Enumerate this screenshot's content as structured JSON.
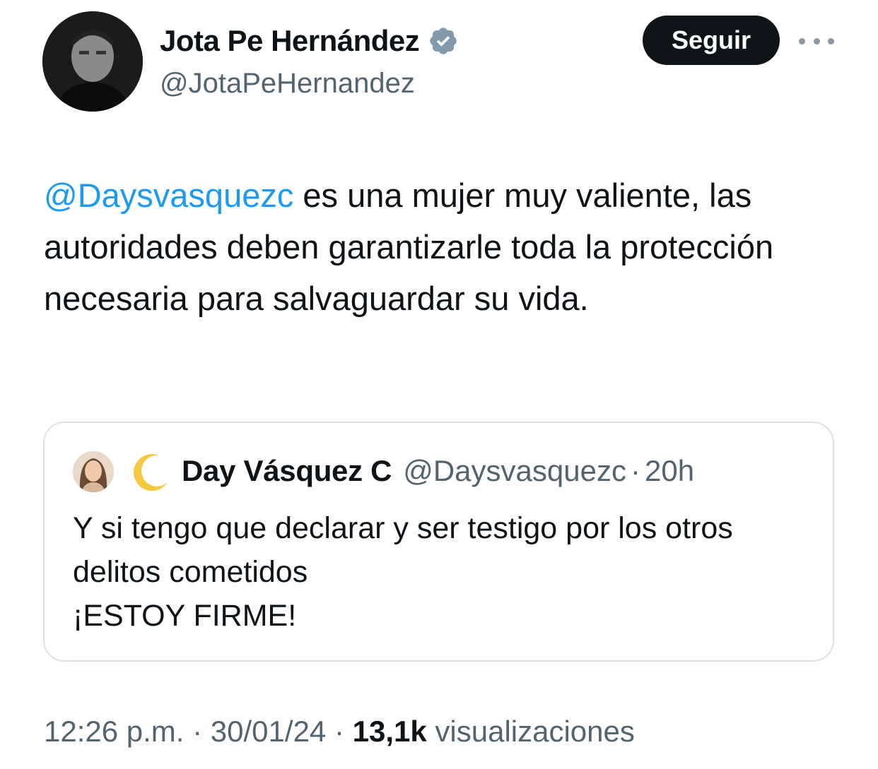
{
  "author": {
    "name": "Jota Pe Hernández",
    "handle": "@JotaPeHernandez",
    "verified": true,
    "avatar_icon": "avatar-photo"
  },
  "actions": {
    "follow_label": "Seguir",
    "more_icon": "more-horizontal-icon"
  },
  "tweet": {
    "mention": "@Daysvasquezc",
    "text": " es una mujer muy valiente, las autoridades deben garantizarle toda la protección necesaria para salvaguardar su vida."
  },
  "quote": {
    "name": "Day Vásquez C",
    "handle": "@Daysvasquezc",
    "separator": "·",
    "time": "20h",
    "emoji": "crescent-moon-icon",
    "text": "Y si tengo que declarar y ser testigo por los otros delitos cometidos\n ¡ESTOY FIRME!"
  },
  "meta": {
    "time": "12:26 p.m.",
    "sep1": " · ",
    "date": "30/01/24",
    "sep2": " · ",
    "views_count": "13,1k",
    "views_label": " visualizaciones"
  },
  "colors": {
    "link": "#1d9bf0",
    "text": "#0f1419",
    "secondary": "#536471",
    "verified": "#829aab",
    "border": "#dbe1e6"
  }
}
